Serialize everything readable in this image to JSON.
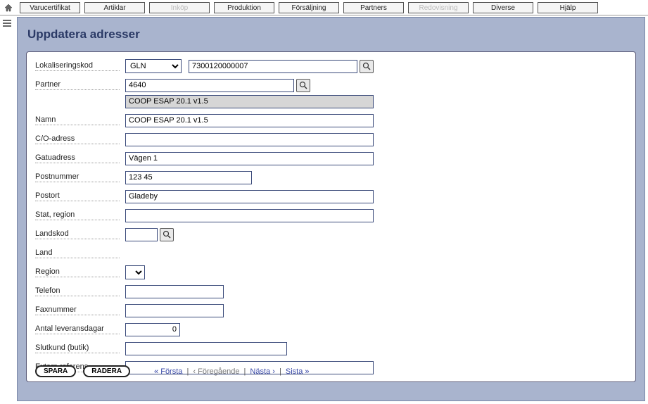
{
  "topbar": {
    "tabs": [
      {
        "label": "Varucertifikat",
        "disabled": false
      },
      {
        "label": "Artiklar",
        "disabled": false
      },
      {
        "label": "Inköp",
        "disabled": true
      },
      {
        "label": "Produktion",
        "disabled": false
      },
      {
        "label": "Försäljning",
        "disabled": false
      },
      {
        "label": "Partners",
        "disabled": false
      },
      {
        "label": "Redovisning",
        "disabled": true
      },
      {
        "label": "Diverse",
        "disabled": false
      },
      {
        "label": "Hjälp",
        "disabled": false
      }
    ]
  },
  "page": {
    "title": "Uppdatera adresser"
  },
  "form": {
    "lokaliseringskod_label": "Lokaliseringskod",
    "lokaliseringskod_type": "GLN",
    "lokaliseringskod_value": "7300120000007",
    "partner_label": "Partner",
    "partner_value": "4640",
    "partner_display": "COOP ESAP 20.1 v1.5",
    "namn_label": "Namn",
    "namn_value": "COOP ESAP 20.1 v1.5",
    "co_label": "C/O-adress",
    "co_value": "",
    "gatu_label": "Gatuadress",
    "gatu_value": "Vägen 1",
    "postnr_label": "Postnummer",
    "postnr_value": "123 45",
    "postort_label": "Postort",
    "postort_value": "Gladeby",
    "stat_label": "Stat, region",
    "stat_value": "",
    "landskod_label": "Landskod",
    "landskod_value": "",
    "land_label": "Land",
    "land_value": "",
    "region_label": "Region",
    "region_value": "",
    "telefon_label": "Telefon",
    "telefon_value": "",
    "fax_label": "Faxnummer",
    "fax_value": "",
    "levdagar_label": "Antal leveransdagar",
    "levdagar_value": "0",
    "slutkund_label": "Slutkund (butik)",
    "slutkund_value": "",
    "extern_label": "Extern referens",
    "extern_value": ""
  },
  "footer": {
    "save": "SPARA",
    "delete": "RADERA",
    "first": "« Första",
    "prev": "‹ Föregående",
    "next": "Nästa ›",
    "last": "Sista »"
  }
}
